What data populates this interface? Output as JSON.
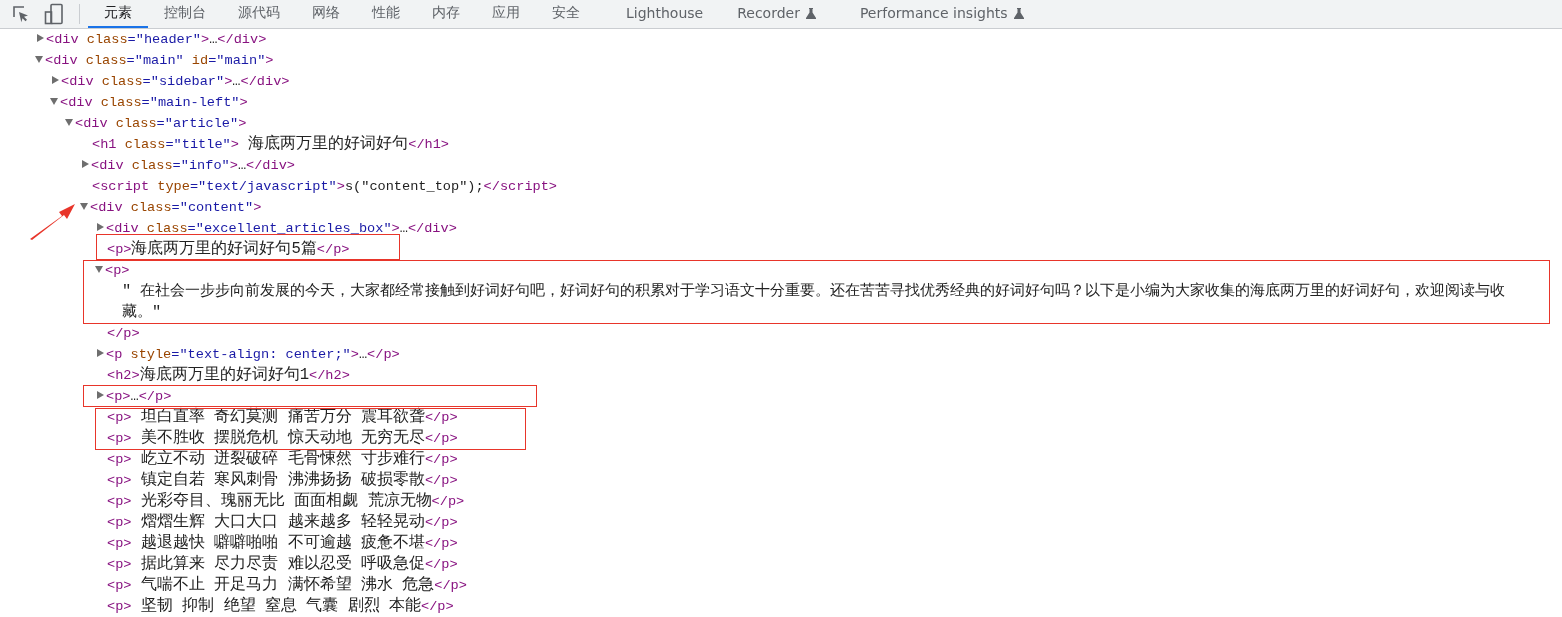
{
  "tabs": [
    {
      "label": "元素",
      "selected": true,
      "experimental": false
    },
    {
      "label": "控制台",
      "selected": false,
      "experimental": false
    },
    {
      "label": "源代码",
      "selected": false,
      "experimental": false
    },
    {
      "label": "网络",
      "selected": false,
      "experimental": false
    },
    {
      "label": "性能",
      "selected": false,
      "experimental": false
    },
    {
      "label": "内存",
      "selected": false,
      "experimental": false
    },
    {
      "label": "应用",
      "selected": false,
      "experimental": false
    },
    {
      "label": "安全",
      "selected": false,
      "experimental": false
    },
    {
      "label": "Lighthouse",
      "selected": false,
      "experimental": false
    },
    {
      "label": "Recorder",
      "selected": false,
      "experimental": true
    },
    {
      "label": "Performance insights",
      "selected": false,
      "experimental": true
    }
  ],
  "dom_tree": {
    "nodes": [
      {
        "kind": "branch",
        "expanded": false,
        "open": [
          {
            "kind": "tag",
            "text": "<div "
          },
          {
            "kind": "attr",
            "text": "class"
          },
          {
            "kind": "value",
            "text": "=\"header\""
          },
          {
            "kind": "tag",
            "text": ">"
          },
          {
            "kind": "text",
            "text": "…"
          },
          {
            "kind": "tag",
            "text": "</div>"
          }
        ]
      },
      {
        "kind": "branch",
        "expanded": true,
        "open": [
          {
            "kind": "tag",
            "text": "<div "
          },
          {
            "kind": "attr",
            "text": "class"
          },
          {
            "kind": "value",
            "text": "=\"main\""
          },
          {
            "kind": "attr",
            "text": " id"
          },
          {
            "kind": "value",
            "text": "=\"main\""
          },
          {
            "kind": "tag",
            "text": ">"
          }
        ],
        "children": [
          {
            "kind": "branch",
            "expanded": false,
            "open": [
              {
                "kind": "tag",
                "text": "<div "
              },
              {
                "kind": "attr",
                "text": "class"
              },
              {
                "kind": "value",
                "text": "=\"sidebar\""
              },
              {
                "kind": "tag",
                "text": ">"
              },
              {
                "kind": "text",
                "text": "…"
              },
              {
                "kind": "tag",
                "text": "</div>"
              }
            ]
          },
          {
            "kind": "branch",
            "expanded": true,
            "open": [
              {
                "kind": "tag",
                "text": "<div "
              },
              {
                "kind": "attr",
                "text": "class"
              },
              {
                "kind": "value",
                "text": "=\"main-left\""
              },
              {
                "kind": "tag",
                "text": ">"
              }
            ],
            "children": [
              {
                "kind": "branch",
                "expanded": true,
                "open": [
                  {
                    "kind": "tag",
                    "text": "<div "
                  },
                  {
                    "kind": "attr",
                    "text": "class"
                  },
                  {
                    "kind": "value",
                    "text": "=\"article\""
                  },
                  {
                    "kind": "tag",
                    "text": ">"
                  }
                ],
                "children": [
                  {
                    "kind": "leaf",
                    "open": [
                      {
                        "kind": "tag",
                        "text": "<h1 "
                      },
                      {
                        "kind": "attr",
                        "text": "class"
                      },
                      {
                        "kind": "value",
                        "text": "=\"title\""
                      },
                      {
                        "kind": "tag",
                        "text": ">"
                      },
                      {
                        "kind": "cjk",
                        "text": " 海底两万里的好词好句"
                      },
                      {
                        "kind": "tag",
                        "text": "</h1>"
                      }
                    ]
                  },
                  {
                    "kind": "branch",
                    "expanded": false,
                    "open": [
                      {
                        "kind": "tag",
                        "text": "<div "
                      },
                      {
                        "kind": "attr",
                        "text": "class"
                      },
                      {
                        "kind": "value",
                        "text": "=\"info\""
                      },
                      {
                        "kind": "tag",
                        "text": ">"
                      },
                      {
                        "kind": "text",
                        "text": "…"
                      },
                      {
                        "kind": "tag",
                        "text": "</div>"
                      }
                    ]
                  },
                  {
                    "kind": "leaf",
                    "open": [
                      {
                        "kind": "tag",
                        "text": "<script "
                      },
                      {
                        "kind": "attr",
                        "text": "type"
                      },
                      {
                        "kind": "value",
                        "text": "=\"text/javascript\""
                      },
                      {
                        "kind": "tag",
                        "text": ">"
                      },
                      {
                        "kind": "text",
                        "text": "s(\"content_top\");"
                      },
                      {
                        "kind": "tag",
                        "text": "</script>"
                      }
                    ]
                  },
                  {
                    "kind": "branch",
                    "expanded": true,
                    "open": [
                      {
                        "kind": "tag",
                        "text": "<div "
                      },
                      {
                        "kind": "attr",
                        "text": "class"
                      },
                      {
                        "kind": "value",
                        "text": "=\"content\""
                      },
                      {
                        "kind": "tag",
                        "text": ">"
                      }
                    ],
                    "children": [
                      {
                        "kind": "branch",
                        "expanded": false,
                        "open": [
                          {
                            "kind": "tag",
                            "text": "<div "
                          },
                          {
                            "kind": "attr",
                            "text": "class"
                          },
                          {
                            "kind": "value",
                            "text": "=\"excellent_articles_box\""
                          },
                          {
                            "kind": "tag",
                            "text": ">"
                          },
                          {
                            "kind": "text",
                            "text": "…"
                          },
                          {
                            "kind": "tag",
                            "text": "</div>"
                          }
                        ]
                      },
                      {
                        "kind": "leaf",
                        "open": [
                          {
                            "kind": "tag",
                            "text": "<p>"
                          },
                          {
                            "kind": "cjk",
                            "text": "海底两万里的好词好句5篇"
                          },
                          {
                            "kind": "tag",
                            "text": "</p>"
                          }
                        ]
                      },
                      {
                        "kind": "branch",
                        "expanded": true,
                        "open": [
                          {
                            "kind": "tag",
                            "text": "<p>"
                          }
                        ],
                        "children": [
                          {
                            "kind": "text",
                            "text": "\" 在社会一步步向前发展的今天，大家都经常接触到好词好句吧，好词好句的积累对于学习语文十分重要。还在苦苦寻找优秀经典的好词好句吗？以下是小编为大家收集的海底两万里的好词好句，欢迎阅读与收藏。\""
                          }
                        ],
                        "close": [
                          {
                            "kind": "tag",
                            "text": "</p>"
                          }
                        ]
                      },
                      {
                        "kind": "branch",
                        "expanded": false,
                        "open": [
                          {
                            "kind": "tag",
                            "text": "<p "
                          },
                          {
                            "kind": "attr",
                            "text": "style"
                          },
                          {
                            "kind": "value",
                            "text": "=\"text-align: center;\""
                          },
                          {
                            "kind": "tag",
                            "text": ">"
                          },
                          {
                            "kind": "text",
                            "text": "…"
                          },
                          {
                            "kind": "tag",
                            "text": "</p>"
                          }
                        ]
                      },
                      {
                        "kind": "leaf",
                        "open": [
                          {
                            "kind": "tag",
                            "text": "<h2>"
                          },
                          {
                            "kind": "cjk",
                            "text": "海底两万里的好词好句1"
                          },
                          {
                            "kind": "tag",
                            "text": "</h2>"
                          }
                        ]
                      },
                      {
                        "kind": "branch",
                        "expanded": false,
                        "open": [
                          {
                            "kind": "tag",
                            "text": "<p>"
                          },
                          {
                            "kind": "text",
                            "text": "…"
                          },
                          {
                            "kind": "tag",
                            "text": "</p>"
                          }
                        ]
                      },
                      {
                        "kind": "leaf",
                        "open": [
                          {
                            "kind": "tag",
                            "text": "<p>"
                          },
                          {
                            "kind": "cjk",
                            "text": " 坦白直率 奇幻莫测 痛苦万分 震耳欲聋"
                          },
                          {
                            "kind": "tag",
                            "text": "</p>"
                          }
                        ]
                      },
                      {
                        "kind": "leaf",
                        "open": [
                          {
                            "kind": "tag",
                            "text": "<p>"
                          },
                          {
                            "kind": "cjk",
                            "text": " 美不胜收 摆脱危机 惊天动地 无穷无尽"
                          },
                          {
                            "kind": "tag",
                            "text": "</p>"
                          }
                        ]
                      },
                      {
                        "kind": "leaf",
                        "open": [
                          {
                            "kind": "tag",
                            "text": "<p>"
                          },
                          {
                            "kind": "cjk",
                            "text": " 屹立不动 迸裂破碎 毛骨悚然 寸步难行"
                          },
                          {
                            "kind": "tag",
                            "text": "</p>"
                          }
                        ]
                      },
                      {
                        "kind": "leaf",
                        "open": [
                          {
                            "kind": "tag",
                            "text": "<p>"
                          },
                          {
                            "kind": "cjk",
                            "text": " 镇定自若 寒风刺骨 沸沸扬扬 破损零散"
                          },
                          {
                            "kind": "tag",
                            "text": "</p>"
                          }
                        ]
                      },
                      {
                        "kind": "leaf",
                        "open": [
                          {
                            "kind": "tag",
                            "text": "<p>"
                          },
                          {
                            "kind": "cjk",
                            "text": " 光彩夺目、瑰丽无比 面面相觑 荒凉无物"
                          },
                          {
                            "kind": "tag",
                            "text": "</p>"
                          }
                        ]
                      },
                      {
                        "kind": "leaf",
                        "open": [
                          {
                            "kind": "tag",
                            "text": "<p>"
                          },
                          {
                            "kind": "cjk",
                            "text": " 熠熠生辉 大口大口 越来越多 轻轻晃动"
                          },
                          {
                            "kind": "tag",
                            "text": "</p>"
                          }
                        ]
                      },
                      {
                        "kind": "leaf",
                        "open": [
                          {
                            "kind": "tag",
                            "text": "<p>"
                          },
                          {
                            "kind": "cjk",
                            "text": " 越退越快 噼噼啪啪 不可逾越 疲惫不堪"
                          },
                          {
                            "kind": "tag",
                            "text": "</p>"
                          }
                        ]
                      },
                      {
                        "kind": "leaf",
                        "open": [
                          {
                            "kind": "tag",
                            "text": "<p>"
                          },
                          {
                            "kind": "cjk",
                            "text": " 据此算来 尽力尽责 难以忍受 呼吸急促"
                          },
                          {
                            "kind": "tag",
                            "text": "</p>"
                          }
                        ]
                      },
                      {
                        "kind": "leaf",
                        "open": [
                          {
                            "kind": "tag",
                            "text": "<p>"
                          },
                          {
                            "kind": "cjk",
                            "text": " 气喘不止 开足马力 满怀希望 沸水 危急"
                          },
                          {
                            "kind": "tag",
                            "text": "</p>"
                          }
                        ]
                      },
                      {
                        "kind": "leaf",
                        "open": [
                          {
                            "kind": "tag",
                            "text": "<p>"
                          },
                          {
                            "kind": "cjk",
                            "text": " 坚韧 抑制 绝望 窒息 气囊 剧烈 本能"
                          },
                          {
                            "kind": "tag",
                            "text": "</p>"
                          }
                        ]
                      }
                    ]
                  }
                ]
              }
            ]
          }
        ]
      }
    ]
  }
}
